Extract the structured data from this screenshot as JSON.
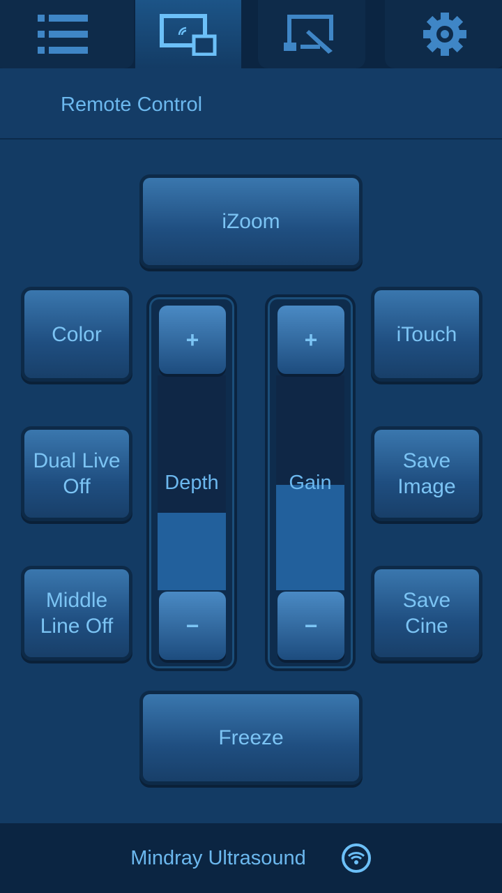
{
  "tabs": [
    {
      "icon": "list-icon",
      "active": false
    },
    {
      "icon": "remote-screen-icon",
      "active": true
    },
    {
      "icon": "screen-edit-icon",
      "active": false
    },
    {
      "icon": "gear-icon",
      "active": false
    }
  ],
  "header": {
    "title": "Remote Control"
  },
  "buttons": {
    "izoom": "iZoom",
    "color": "Color",
    "dual_live": "Dual Live Off",
    "middle_line": "Middle Line Off",
    "itouch": "iTouch",
    "save_image": "Save Image",
    "save_cine": "Save Cine",
    "freeze": "Freeze"
  },
  "sliders": {
    "depth": {
      "label": "Depth",
      "plus": "+",
      "minus": "−",
      "level_percent": 36
    },
    "gain": {
      "label": "Gain",
      "plus": "+",
      "minus": "−",
      "level_percent": 49
    }
  },
  "footer": {
    "device": "Mindray Ultrasound",
    "status_icon": "wifi-icon"
  },
  "colors": {
    "background": "#133b64",
    "accent": "#6cb8ee",
    "fill": "#22609c"
  }
}
